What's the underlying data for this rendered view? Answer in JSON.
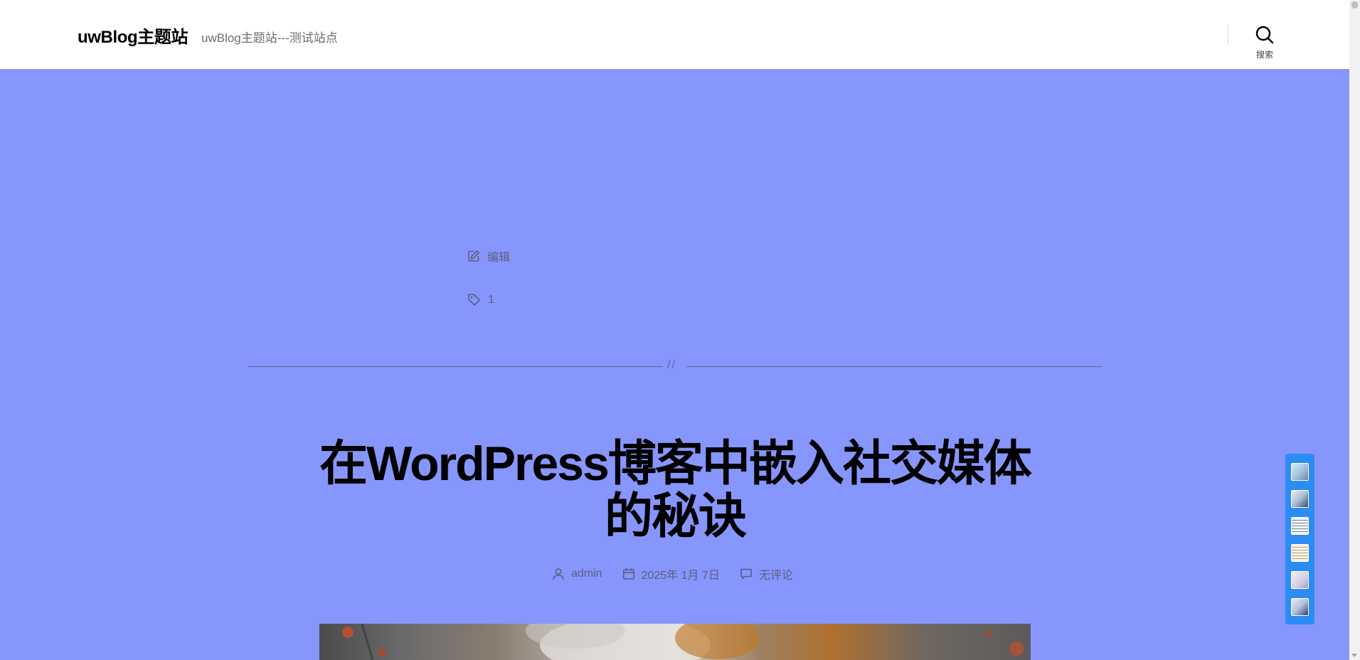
{
  "header": {
    "site_title": "uwBlog主题站",
    "site_description": "uwBlog主题站---测试站点",
    "search_label": "搜索"
  },
  "previous_post": {
    "edit_label": "编辑",
    "tag_label": "1"
  },
  "separator": {
    "symbol": "//"
  },
  "post": {
    "title": "在WordPress博客中嵌入社交媒体的秘诀",
    "author": "admin",
    "date": "2025年 1月 7日",
    "comments": "无评论"
  },
  "float_panel": {
    "thumbnails": [
      "thumbnail-1",
      "thumbnail-2",
      "thumbnail-3",
      "thumbnail-4",
      "thumbnail-5",
      "thumbnail-6"
    ]
  },
  "colors": {
    "page_background": "#8696fd",
    "header_background": "#ffffff",
    "panel_accent": "#2c8cf5",
    "meta_text": "#5a5e7d"
  },
  "icons": {
    "search": "search-icon",
    "edit": "edit-icon",
    "tag": "tag-icon",
    "author": "user-icon",
    "date": "calendar-icon",
    "comments": "comment-icon"
  }
}
